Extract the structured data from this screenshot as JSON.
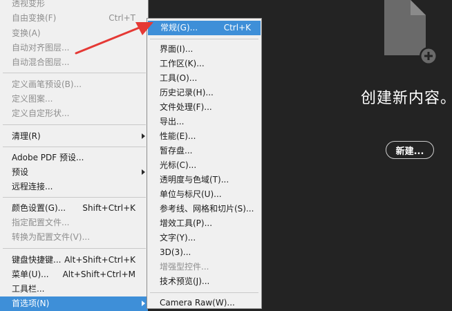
{
  "workspace": {
    "create_text": "创建新内容。",
    "new_button": "新建..."
  },
  "colors": {
    "workspace_bg": "#232323",
    "menu_bg": "#f0f0f0",
    "highlight": "#3e8fd8",
    "annotation_arrow": "#e53935"
  },
  "main_menu": {
    "items": [
      {
        "label": "透视变形",
        "disabled": true
      },
      {
        "label": "自由变换(F)",
        "shortcut": "Ctrl+T",
        "disabled": true
      },
      {
        "label": "变换(A)",
        "disabled": true
      },
      {
        "label": "自动对齐图层...",
        "disabled": true
      },
      {
        "label": "自动混合图层...",
        "disabled": true
      },
      {
        "label": "定义画笔预设(B)...",
        "disabled": true
      },
      {
        "label": "定义图案...",
        "disabled": true
      },
      {
        "label": "定义自定形状...",
        "disabled": true
      },
      {
        "label": "清理(R)",
        "has_submenu": true
      },
      {
        "label": "Adobe PDF 预设..."
      },
      {
        "label": "预设",
        "has_submenu": true
      },
      {
        "label": "远程连接..."
      },
      {
        "label": "颜色设置(G)...",
        "shortcut": "Shift+Ctrl+K"
      },
      {
        "label": "指定配置文件...",
        "disabled": true
      },
      {
        "label": "转换为配置文件(V)...",
        "disabled": true
      },
      {
        "label": "键盘快捷键...",
        "shortcut": "Alt+Shift+Ctrl+K"
      },
      {
        "label": "菜单(U)...",
        "shortcut": "Alt+Shift+Ctrl+M"
      },
      {
        "label": "工具栏..."
      },
      {
        "label": "首选项(N)",
        "has_submenu": true,
        "highlighted": true
      }
    ]
  },
  "submenu": {
    "items": [
      {
        "label": "常规(G)...",
        "shortcut": "Ctrl+K",
        "highlighted": true
      },
      {
        "label": "界面(I)..."
      },
      {
        "label": "工作区(K)..."
      },
      {
        "label": "工具(O)..."
      },
      {
        "label": "历史记录(H)..."
      },
      {
        "label": "文件处理(F)..."
      },
      {
        "label": "导出..."
      },
      {
        "label": "性能(E)..."
      },
      {
        "label": "暂存盘..."
      },
      {
        "label": "光标(C)..."
      },
      {
        "label": "透明度与色域(T)..."
      },
      {
        "label": "单位与标尺(U)..."
      },
      {
        "label": "参考线、网格和切片(S)..."
      },
      {
        "label": "增效工具(P)..."
      },
      {
        "label": "文字(Y)..."
      },
      {
        "label": "3D(3)..."
      },
      {
        "label": "增强型控件...",
        "disabled": true
      },
      {
        "label": "技术预览(J)..."
      },
      {
        "label": "Camera Raw(W)..."
      }
    ]
  },
  "icons": {
    "doc": "new-document-icon",
    "plus": "plus-circle-icon",
    "submenu_arrow": "chevron-right-icon",
    "annotation": "red-arrow-icon"
  }
}
